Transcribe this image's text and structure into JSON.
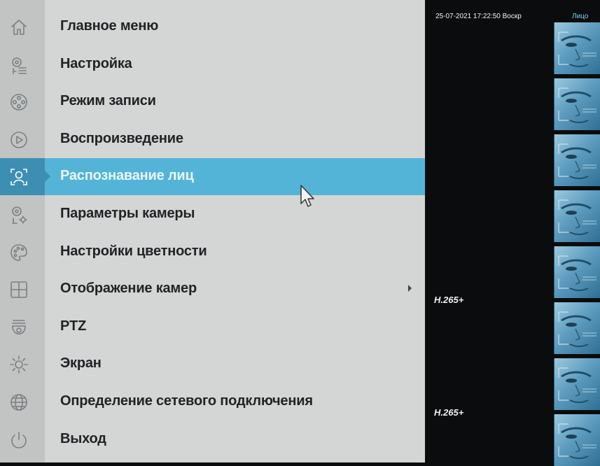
{
  "menu": {
    "items": [
      {
        "label": "Главное меню",
        "icon": "home-icon"
      },
      {
        "label": "Настройка",
        "icon": "camera-settings-icon"
      },
      {
        "label": "Режим записи",
        "icon": "film-reel-icon"
      },
      {
        "label": "Воспроизведение",
        "icon": "play-icon"
      },
      {
        "label": "Распознавание лиц",
        "icon": "face-recognition-icon"
      },
      {
        "label": "Параметры камеры",
        "icon": "camera-gear-icon"
      },
      {
        "label": "Настройки цветности",
        "icon": "palette-icon"
      },
      {
        "label": "Отображение камер",
        "icon": "grid-icon"
      },
      {
        "label": "PTZ",
        "icon": "ptz-camera-icon"
      },
      {
        "label": "Экран",
        "icon": "brightness-icon"
      },
      {
        "label": "Определение сетевого подключения",
        "icon": "globe-icon"
      },
      {
        "label": "Выход",
        "icon": "power-icon"
      }
    ],
    "active_index": 4,
    "submenu_index": 7
  },
  "video": {
    "datetime": "25-07-2021 17:22:50 Воскр",
    "face_label": "Лицо",
    "codec_1": "H.265+",
    "codec_2": "H.265+"
  },
  "colors": {
    "menu_bg": "#d4d6d6",
    "icon_column": "#c2c4c4",
    "active_bg": "#54b4d8",
    "active_tab": "#3c8fb2",
    "text": "#202325",
    "video_bg": "#0b0c0e"
  }
}
